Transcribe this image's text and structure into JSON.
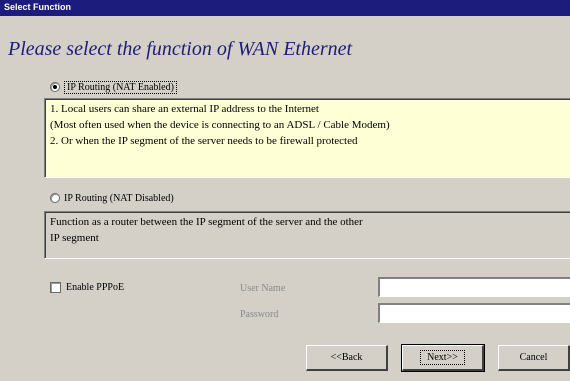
{
  "window": {
    "title": "Select Function"
  },
  "heading": "Please select the function of WAN Ethernet",
  "options": [
    {
      "label": "IP Routing (NAT Enabled)",
      "selected": true,
      "description": [
        "1. Local users can share an external IP address to the Internet",
        "(Most often used when the device is connecting to an ADSL / Cable Modem)",
        "2. Or when the IP segment of the server needs to be firewall protected"
      ]
    },
    {
      "label": "IP Routing (NAT Disabled)",
      "selected": false,
      "description": [
        "Function as a router between the IP segment of the server and the other",
        "IP segment"
      ]
    }
  ],
  "pppoe": {
    "checkbox_label": "Enable PPPoE",
    "checked": false,
    "username_label": "User Name",
    "password_label": "Password",
    "username_value": "",
    "password_value": ""
  },
  "buttons": {
    "back": "<<Back",
    "next": "Next>>",
    "cancel": "Cancel"
  },
  "colors": {
    "titlebar": "#1c1c7c",
    "heading": "#1c1c7c",
    "highlight_box": "#ffffd6",
    "dialog_bg": "#d4d0c8"
  }
}
